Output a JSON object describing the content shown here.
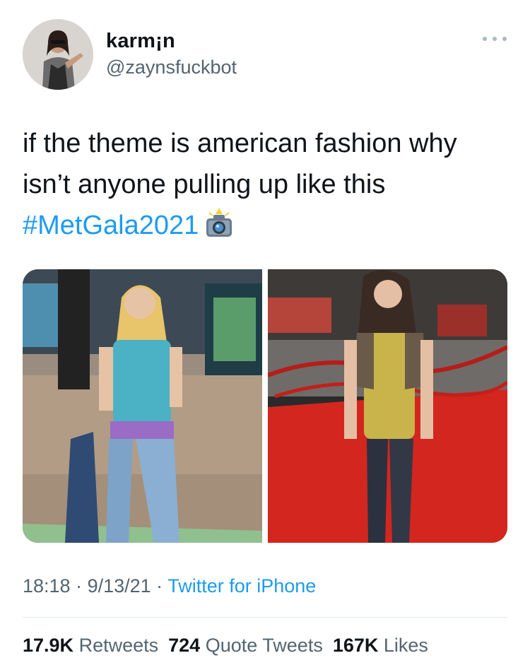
{
  "author": {
    "display_name": "karm¡n",
    "handle": "@zaynsfuckbot"
  },
  "tweet": {
    "line1": "if the theme is american fashion why",
    "line2": "isn’t anyone pulling up like this",
    "hashtag": "#MetGala2021",
    "emoji": "camera-with-flash-icon"
  },
  "meta": {
    "time": "18:18",
    "separator1": " · ",
    "date": "9/13/21",
    "separator2": " · ",
    "source": "Twitter for iPhone"
  },
  "stats": {
    "retweets_count": "17.9K",
    "retweets_label": "Retweets",
    "quotes_count": "724",
    "quotes_label": "Quote Tweets",
    "likes_count": "167K",
    "likes_label": "Likes"
  },
  "colors": {
    "link": "#1d9bf0",
    "secondary_text": "#536471",
    "primary_text": "#0f1419"
  }
}
